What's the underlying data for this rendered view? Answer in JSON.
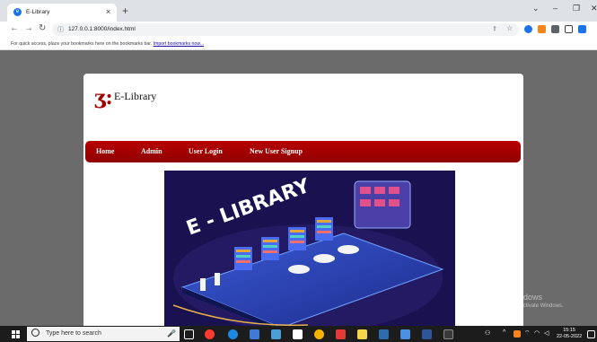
{
  "browser": {
    "tab_title": "E-Library",
    "tab_close": "×",
    "new_tab": "+",
    "window_minimize": "–",
    "window_restore": "❐",
    "window_close": "✕",
    "window_menu": "⌄",
    "url": "127.0.0.1:8000/index.html",
    "bookmark_message": "For quick access, place your bookmarks here on the bookmarks bar.",
    "bookmark_link": "Import bookmarks now..."
  },
  "site": {
    "logo_glyph": "ʒ:",
    "name": "E-Library",
    "nav": [
      {
        "label": "Home"
      },
      {
        "label": "Admin"
      },
      {
        "label": "User Login"
      },
      {
        "label": "New User Signup"
      }
    ],
    "hero_text": "E - LIBRARY"
  },
  "watermark": {
    "line1": "Activate Windows",
    "line2": "Go to Settings to activate Windows."
  },
  "taskbar": {
    "search_placeholder": "Type here to search",
    "time": "15:15",
    "date": "22-05-2022"
  },
  "colors": {
    "menu_red": "#a80000",
    "hero_bg": "#1a1250",
    "accent_blue": "#1a73e8"
  }
}
